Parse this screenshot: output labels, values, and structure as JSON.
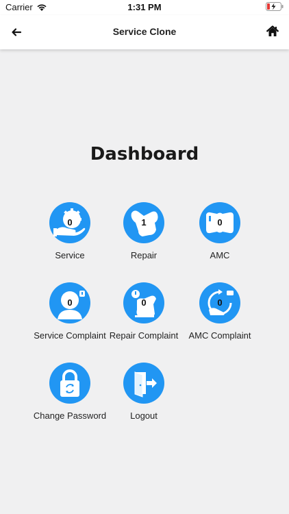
{
  "status": {
    "carrier": "Carrier",
    "time": "1:31 PM"
  },
  "nav": {
    "title": "Service Clone"
  },
  "dashboard": {
    "title": "Dashboard",
    "accent": "#2196f3",
    "tiles": [
      {
        "label": "Service",
        "count": "0",
        "icon": "service-hand-gear-icon"
      },
      {
        "label": "Repair",
        "count": "1",
        "icon": "repair-wrench-icon"
      },
      {
        "label": "AMC",
        "count": "0",
        "icon": "amc-icon"
      },
      {
        "label": "Service Complaint",
        "count": "0",
        "icon": "service-complaint-person-icon"
      },
      {
        "label": "Repair Complaint",
        "count": "0",
        "icon": "repair-complaint-icon"
      },
      {
        "label": "AMC Complaint",
        "count": "0",
        "icon": "amc-complaint-icon"
      },
      {
        "label": "Change Password",
        "icon": "lock-icon"
      },
      {
        "label": "Logout",
        "icon": "logout-door-icon"
      }
    ]
  }
}
